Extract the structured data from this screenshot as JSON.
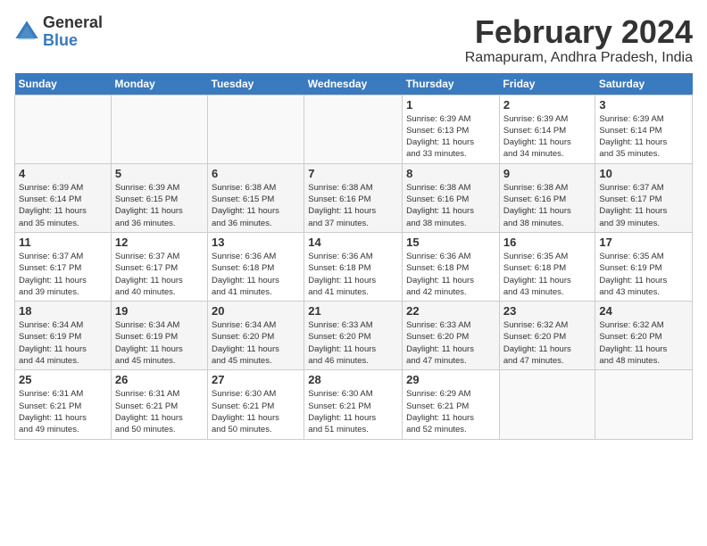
{
  "logo": {
    "general": "General",
    "blue": "Blue"
  },
  "title": "February 2024",
  "subtitle": "Ramapuram, Andhra Pradesh, India",
  "days_of_week": [
    "Sunday",
    "Monday",
    "Tuesday",
    "Wednesday",
    "Thursday",
    "Friday",
    "Saturday"
  ],
  "weeks": [
    [
      {
        "day": "",
        "info": ""
      },
      {
        "day": "",
        "info": ""
      },
      {
        "day": "",
        "info": ""
      },
      {
        "day": "",
        "info": ""
      },
      {
        "day": "1",
        "info": "Sunrise: 6:39 AM\nSunset: 6:13 PM\nDaylight: 11 hours\nand 33 minutes."
      },
      {
        "day": "2",
        "info": "Sunrise: 6:39 AM\nSunset: 6:14 PM\nDaylight: 11 hours\nand 34 minutes."
      },
      {
        "day": "3",
        "info": "Sunrise: 6:39 AM\nSunset: 6:14 PM\nDaylight: 11 hours\nand 35 minutes."
      }
    ],
    [
      {
        "day": "4",
        "info": "Sunrise: 6:39 AM\nSunset: 6:14 PM\nDaylight: 11 hours\nand 35 minutes."
      },
      {
        "day": "5",
        "info": "Sunrise: 6:39 AM\nSunset: 6:15 PM\nDaylight: 11 hours\nand 36 minutes."
      },
      {
        "day": "6",
        "info": "Sunrise: 6:38 AM\nSunset: 6:15 PM\nDaylight: 11 hours\nand 36 minutes."
      },
      {
        "day": "7",
        "info": "Sunrise: 6:38 AM\nSunset: 6:16 PM\nDaylight: 11 hours\nand 37 minutes."
      },
      {
        "day": "8",
        "info": "Sunrise: 6:38 AM\nSunset: 6:16 PM\nDaylight: 11 hours\nand 38 minutes."
      },
      {
        "day": "9",
        "info": "Sunrise: 6:38 AM\nSunset: 6:16 PM\nDaylight: 11 hours\nand 38 minutes."
      },
      {
        "day": "10",
        "info": "Sunrise: 6:37 AM\nSunset: 6:17 PM\nDaylight: 11 hours\nand 39 minutes."
      }
    ],
    [
      {
        "day": "11",
        "info": "Sunrise: 6:37 AM\nSunset: 6:17 PM\nDaylight: 11 hours\nand 39 minutes."
      },
      {
        "day": "12",
        "info": "Sunrise: 6:37 AM\nSunset: 6:17 PM\nDaylight: 11 hours\nand 40 minutes."
      },
      {
        "day": "13",
        "info": "Sunrise: 6:36 AM\nSunset: 6:18 PM\nDaylight: 11 hours\nand 41 minutes."
      },
      {
        "day": "14",
        "info": "Sunrise: 6:36 AM\nSunset: 6:18 PM\nDaylight: 11 hours\nand 41 minutes."
      },
      {
        "day": "15",
        "info": "Sunrise: 6:36 AM\nSunset: 6:18 PM\nDaylight: 11 hours\nand 42 minutes."
      },
      {
        "day": "16",
        "info": "Sunrise: 6:35 AM\nSunset: 6:18 PM\nDaylight: 11 hours\nand 43 minutes."
      },
      {
        "day": "17",
        "info": "Sunrise: 6:35 AM\nSunset: 6:19 PM\nDaylight: 11 hours\nand 43 minutes."
      }
    ],
    [
      {
        "day": "18",
        "info": "Sunrise: 6:34 AM\nSunset: 6:19 PM\nDaylight: 11 hours\nand 44 minutes."
      },
      {
        "day": "19",
        "info": "Sunrise: 6:34 AM\nSunset: 6:19 PM\nDaylight: 11 hours\nand 45 minutes."
      },
      {
        "day": "20",
        "info": "Sunrise: 6:34 AM\nSunset: 6:20 PM\nDaylight: 11 hours\nand 45 minutes."
      },
      {
        "day": "21",
        "info": "Sunrise: 6:33 AM\nSunset: 6:20 PM\nDaylight: 11 hours\nand 46 minutes."
      },
      {
        "day": "22",
        "info": "Sunrise: 6:33 AM\nSunset: 6:20 PM\nDaylight: 11 hours\nand 47 minutes."
      },
      {
        "day": "23",
        "info": "Sunrise: 6:32 AM\nSunset: 6:20 PM\nDaylight: 11 hours\nand 47 minutes."
      },
      {
        "day": "24",
        "info": "Sunrise: 6:32 AM\nSunset: 6:20 PM\nDaylight: 11 hours\nand 48 minutes."
      }
    ],
    [
      {
        "day": "25",
        "info": "Sunrise: 6:31 AM\nSunset: 6:21 PM\nDaylight: 11 hours\nand 49 minutes."
      },
      {
        "day": "26",
        "info": "Sunrise: 6:31 AM\nSunset: 6:21 PM\nDaylight: 11 hours\nand 50 minutes."
      },
      {
        "day": "27",
        "info": "Sunrise: 6:30 AM\nSunset: 6:21 PM\nDaylight: 11 hours\nand 50 minutes."
      },
      {
        "day": "28",
        "info": "Sunrise: 6:30 AM\nSunset: 6:21 PM\nDaylight: 11 hours\nand 51 minutes."
      },
      {
        "day": "29",
        "info": "Sunrise: 6:29 AM\nSunset: 6:21 PM\nDaylight: 11 hours\nand 52 minutes."
      },
      {
        "day": "",
        "info": ""
      },
      {
        "day": "",
        "info": ""
      }
    ]
  ]
}
